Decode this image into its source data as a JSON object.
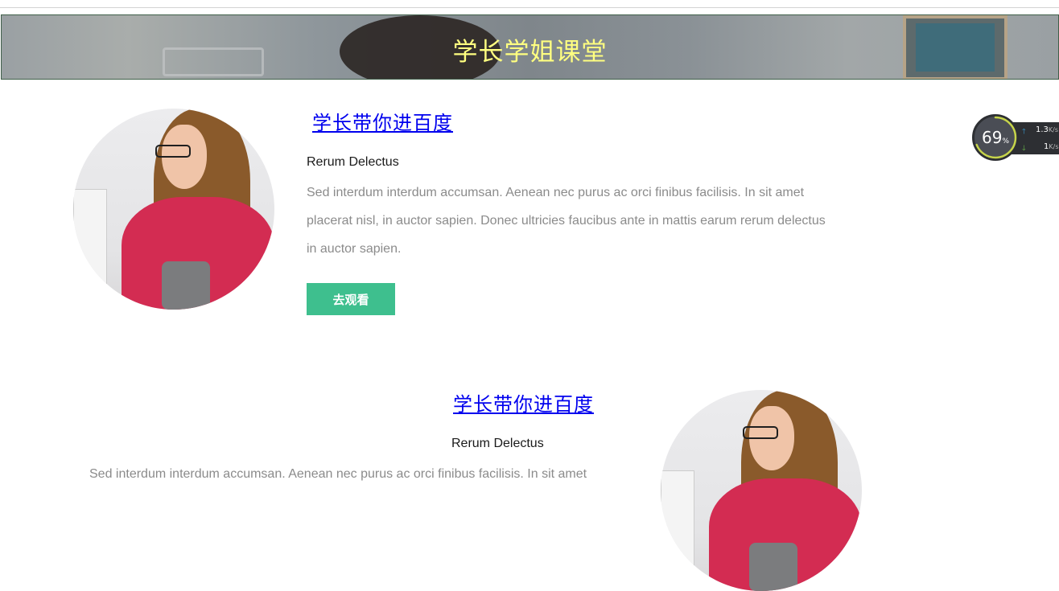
{
  "banner": {
    "title": "学长学姐课堂"
  },
  "cards": [
    {
      "title": "学长带你进百度",
      "subtitle": "Rerum Delectus",
      "text_lines": [
        "Sed interdum interdum accumsan. Aenean nec purus ac orci finibus facilisis. In sit amet",
        "placerat nisl, in auctor sapien. Donec ultricies faucibus ante in mattis earum rerum delectus",
        "in auctor sapien."
      ],
      "button": "去观看"
    },
    {
      "title": "学长带你进百度",
      "subtitle": "Rerum Delectus",
      "text_lines": [
        "Sed interdum interdum accumsan. Aenean nec purus ac orci finibus facilisis. In sit amet"
      ]
    }
  ],
  "speed_widget": {
    "percent": "69",
    "percent_unit": "%",
    "up_value": "1.3",
    "up_unit": "K/s",
    "down_value": "1",
    "down_unit": "K/s",
    "ring_color": "#c6d44a",
    "up_color": "#3aa0d8",
    "down_color": "#6bbf4a"
  }
}
